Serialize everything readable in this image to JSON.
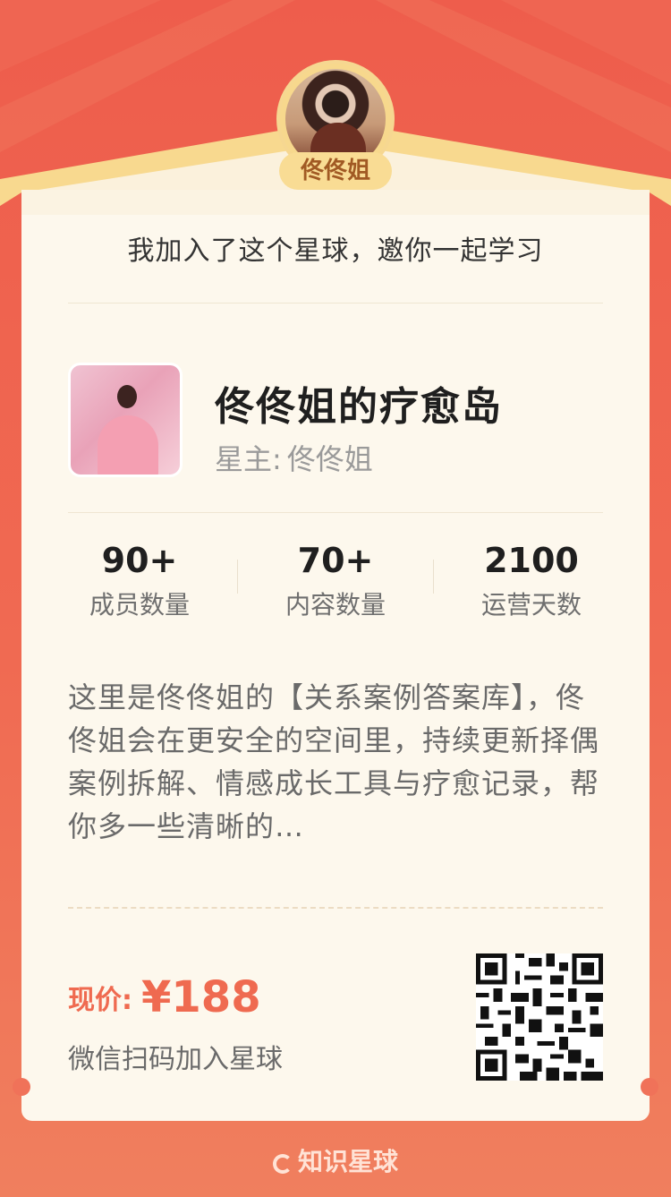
{
  "host": {
    "name": "佟佟姐",
    "invite_text": "我加入了这个星球，邀你一起学习"
  },
  "group": {
    "title": "佟佟姐的疗愈岛",
    "owner_prefix": "星主:",
    "owner_name": "佟佟姐"
  },
  "stats": [
    {
      "value": "90+",
      "label": "成员数量"
    },
    {
      "value": "70+",
      "label": "内容数量"
    },
    {
      "value": "2100",
      "label": "运营天数"
    }
  ],
  "description": "这里是佟佟姐的【关系案例答案库】，佟佟姐会在更安全的空间里，持续更新择偶案例拆解、情感成长工具与疗愈记录，帮你多一些清晰的…",
  "pricing": {
    "label": "现价:",
    "value": "¥188",
    "scan_hint": "微信扫码加入星球"
  },
  "brand": {
    "name": "知识星球"
  },
  "colors": {
    "primary": "#ee5d4c",
    "accent": "#f7d88d",
    "card_bg": "#fdf8ed",
    "price": "#ef6a50"
  }
}
